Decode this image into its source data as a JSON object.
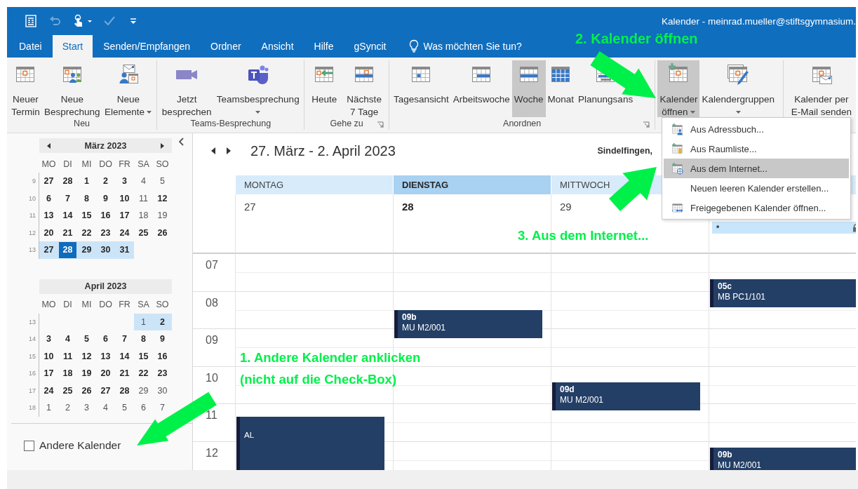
{
  "window": {
    "title": "Kalender - meinrad.mueller@stiftsgymnasium."
  },
  "quick_access": [
    {
      "disabled": false
    },
    {
      "disabled": true
    },
    {
      "disabled": false
    },
    {
      "disabled": true
    },
    {
      "disabled": false
    }
  ],
  "tabs": [
    {
      "label": "Datei",
      "selected": false
    },
    {
      "label": "Start",
      "selected": true
    },
    {
      "label": "Senden/Empfangen",
      "selected": false
    },
    {
      "label": "Ordner",
      "selected": false
    },
    {
      "label": "Ansicht",
      "selected": false
    },
    {
      "label": "Hilfe",
      "selected": false
    },
    {
      "label": "gSyncit",
      "selected": false
    }
  ],
  "tell_me": {
    "placeholder": "Was möchten Sie tun?"
  },
  "ribbon": {
    "groups": [
      {
        "label": "Neu",
        "launcher": false,
        "buttons": [
          {
            "lines": [
              "Neuer",
              "Termin"
            ],
            "dropdown": false,
            "selected": false
          },
          {
            "lines": [
              "Neue",
              "Besprechung"
            ],
            "dropdown": false,
            "selected": false
          },
          {
            "lines": [
              "Neue",
              "Elemente"
            ],
            "dropdown": true,
            "selected": false
          }
        ]
      },
      {
        "label": "Teams-Besprechung",
        "launcher": false,
        "buttons": [
          {
            "lines": [
              "Jetzt",
              "besprechen"
            ],
            "dropdown": false,
            "selected": false
          },
          {
            "lines": [
              "Teamsbesprechung"
            ],
            "dropdown": true,
            "selected": false
          }
        ]
      },
      {
        "label": "Gehe zu",
        "launcher": true,
        "buttons": [
          {
            "lines": [
              "Heute"
            ],
            "dropdown": false,
            "selected": false
          },
          {
            "lines": [
              "Nächste",
              "7 Tage"
            ],
            "dropdown": false,
            "selected": false
          }
        ]
      },
      {
        "label": "Anordnen",
        "launcher": true,
        "buttons": [
          {
            "lines": [
              "Tagesansicht"
            ],
            "dropdown": false,
            "selected": false
          },
          {
            "lines": [
              "Arbeitswoche"
            ],
            "dropdown": false,
            "selected": false
          },
          {
            "lines": [
              "Woche"
            ],
            "dropdown": false,
            "selected": true
          },
          {
            "lines": [
              "Monat"
            ],
            "dropdown": false,
            "selected": false
          },
          {
            "lines": [
              "Planungsans"
            ],
            "dropdown": false,
            "selected": false
          }
        ]
      },
      {
        "buttons": [
          {
            "lines": [
              "Kalender",
              "öffnen"
            ],
            "dropdown": true,
            "selected": true
          },
          {
            "lines": [
              "Kalendergruppen"
            ],
            "dropdown": true,
            "selected": false
          }
        ]
      },
      {
        "buttons": [
          {
            "lines": [
              "Kalender per",
              "E-Mail senden"
            ],
            "dropdown": false,
            "selected": false
          }
        ]
      }
    ]
  },
  "mini_calendars": [
    {
      "title": "März 2023",
      "nav": true,
      "weekdays": [
        "MO",
        "DI",
        "MI",
        "DO",
        "FR",
        "SA",
        "SO"
      ],
      "weeks": [
        {
          "week": "9",
          "days": [
            {
              "kind": "day",
              "d": "27",
              "bold": true,
              "selected": false,
              "today": false
            },
            {
              "kind": "day",
              "d": "28",
              "bold": true,
              "selected": false,
              "today": false
            },
            {
              "kind": "day",
              "d": "1",
              "bold": true,
              "selected": false,
              "today": false
            },
            {
              "kind": "day",
              "d": "2",
              "bold": true,
              "selected": false,
              "today": false
            },
            {
              "kind": "day",
              "d": "3",
              "bold": true,
              "selected": false,
              "today": false
            },
            {
              "kind": "day",
              "d": "4",
              "bold": false,
              "selected": false,
              "today": false
            },
            {
              "kind": "day",
              "d": "5",
              "bold": false,
              "selected": false,
              "today": false
            }
          ]
        },
        {
          "week": "10",
          "days": [
            {
              "kind": "day",
              "d": "6",
              "bold": true,
              "selected": false,
              "today": false
            },
            {
              "kind": "day",
              "d": "7",
              "bold": true,
              "selected": false,
              "today": false
            },
            {
              "kind": "day",
              "d": "8",
              "bold": true,
              "selected": false,
              "today": false
            },
            {
              "kind": "day",
              "d": "9",
              "bold": true,
              "selected": false,
              "today": false
            },
            {
              "kind": "day",
              "d": "10",
              "bold": true,
              "selected": false,
              "today": false
            },
            {
              "kind": "day",
              "d": "11",
              "bold": false,
              "selected": false,
              "today": false
            },
            {
              "kind": "day",
              "d": "12",
              "bold": true,
              "selected": false,
              "today": false
            }
          ]
        },
        {
          "week": "11",
          "days": [
            {
              "kind": "day",
              "d": "13",
              "bold": true,
              "selected": false,
              "today": false
            },
            {
              "kind": "day",
              "d": "14",
              "bold": true,
              "selected": false,
              "today": false
            },
            {
              "kind": "day",
              "d": "15",
              "bold": true,
              "selected": false,
              "today": false
            },
            {
              "kind": "day",
              "d": "16",
              "bold": true,
              "selected": false,
              "today": false
            },
            {
              "kind": "day",
              "d": "17",
              "bold": true,
              "selected": false,
              "today": false
            },
            {
              "kind": "day",
              "d": "18",
              "bold": false,
              "selected": false,
              "today": false
            },
            {
              "kind": "day",
              "d": "19",
              "bold": false,
              "selected": false,
              "today": false
            }
          ]
        },
        {
          "week": "12",
          "days": [
            {
              "kind": "day",
              "d": "20",
              "bold": true,
              "selected": false,
              "today": false
            },
            {
              "kind": "day",
              "d": "21",
              "bold": true,
              "selected": false,
              "today": false
            },
            {
              "kind": "day",
              "d": "22",
              "bold": true,
              "selected": false,
              "today": false
            },
            {
              "kind": "day",
              "d": "23",
              "bold": true,
              "selected": false,
              "today": false
            },
            {
              "kind": "day",
              "d": "24",
              "bold": true,
              "selected": false,
              "today": false
            },
            {
              "kind": "day",
              "d": "25",
              "bold": true,
              "selected": false,
              "today": false
            },
            {
              "kind": "day",
              "d": "26",
              "bold": true,
              "selected": false,
              "today": false
            }
          ]
        },
        {
          "week": "13",
          "days": [
            {
              "kind": "day",
              "d": "27",
              "bold": true,
              "selected": true,
              "today": false
            },
            {
              "kind": "day",
              "d": "28",
              "bold": true,
              "selected": true,
              "today": true
            },
            {
              "kind": "day",
              "d": "29",
              "bold": true,
              "selected": true,
              "today": false
            },
            {
              "kind": "day",
              "d": "30",
              "bold": true,
              "selected": true,
              "today": false
            },
            {
              "kind": "day",
              "d": "31",
              "bold": true,
              "selected": true,
              "today": false
            },
            {
              "kind": "blank"
            },
            {
              "kind": "blank"
            }
          ]
        }
      ]
    },
    {
      "title": "April 2023",
      "nav": false,
      "weekdays": [
        "MO",
        "DI",
        "MI",
        "DO",
        "FR",
        "SA",
        "SO"
      ],
      "weeks": [
        {
          "week": "13",
          "days": [
            {
              "kind": "blank"
            },
            {
              "kind": "blank"
            },
            {
              "kind": "blank"
            },
            {
              "kind": "blank"
            },
            {
              "kind": "blank"
            },
            {
              "kind": "day",
              "d": "1",
              "bold": false,
              "selected": true,
              "today": false
            },
            {
              "kind": "day",
              "d": "2",
              "bold": true,
              "selected": true,
              "today": false
            }
          ]
        },
        {
          "week": "14",
          "days": [
            {
              "kind": "day",
              "d": "3",
              "bold": true,
              "selected": false,
              "today": false
            },
            {
              "kind": "day",
              "d": "4",
              "bold": true,
              "selected": false,
              "today": false
            },
            {
              "kind": "day",
              "d": "5",
              "bold": true,
              "selected": false,
              "today": false
            },
            {
              "kind": "day",
              "d": "6",
              "bold": true,
              "selected": false,
              "today": false
            },
            {
              "kind": "day",
              "d": "7",
              "bold": true,
              "selected": false,
              "today": false
            },
            {
              "kind": "day",
              "d": "8",
              "bold": true,
              "selected": false,
              "today": false
            },
            {
              "kind": "day",
              "d": "9",
              "bold": true,
              "selected": false,
              "today": false
            }
          ]
        },
        {
          "week": "15",
          "days": [
            {
              "kind": "day",
              "d": "10",
              "bold": true,
              "selected": false,
              "today": false
            },
            {
              "kind": "day",
              "d": "11",
              "bold": true,
              "selected": false,
              "today": false
            },
            {
              "kind": "day",
              "d": "12",
              "bold": true,
              "selected": false,
              "today": false
            },
            {
              "kind": "day",
              "d": "13",
              "bold": true,
              "selected": false,
              "today": false
            },
            {
              "kind": "day",
              "d": "14",
              "bold": true,
              "selected": false,
              "today": false
            },
            {
              "kind": "day",
              "d": "15",
              "bold": true,
              "selected": false,
              "today": false
            },
            {
              "kind": "day",
              "d": "16",
              "bold": true,
              "selected": false,
              "today": false
            }
          ]
        },
        {
          "week": "16",
          "days": [
            {
              "kind": "day",
              "d": "17",
              "bold": true,
              "selected": false,
              "today": false
            },
            {
              "kind": "day",
              "d": "18",
              "bold": true,
              "selected": false,
              "today": false
            },
            {
              "kind": "day",
              "d": "19",
              "bold": true,
              "selected": false,
              "today": false
            },
            {
              "kind": "day",
              "d": "20",
              "bold": true,
              "selected": false,
              "today": false
            },
            {
              "kind": "day",
              "d": "21",
              "bold": true,
              "selected": false,
              "today": false
            },
            {
              "kind": "day",
              "d": "22",
              "bold": true,
              "selected": false,
              "today": false
            },
            {
              "kind": "day",
              "d": "23",
              "bold": true,
              "selected": false,
              "today": false
            }
          ]
        },
        {
          "week": "17",
          "days": [
            {
              "kind": "day",
              "d": "24",
              "bold": true,
              "selected": false,
              "today": false
            },
            {
              "kind": "day",
              "d": "25",
              "bold": true,
              "selected": false,
              "today": false
            },
            {
              "kind": "day",
              "d": "26",
              "bold": true,
              "selected": false,
              "today": false
            },
            {
              "kind": "day",
              "d": "27",
              "bold": true,
              "selected": false,
              "today": false
            },
            {
              "kind": "day",
              "d": "28",
              "bold": true,
              "selected": false,
              "today": false
            },
            {
              "kind": "day",
              "d": "29",
              "bold": false,
              "selected": false,
              "today": false
            },
            {
              "kind": "day",
              "d": "30",
              "bold": false,
              "selected": false,
              "today": false
            }
          ]
        },
        {
          "week": "18",
          "days": [
            {
              "kind": "day",
              "d": "1",
              "bold": false,
              "selected": false,
              "today": false
            },
            {
              "kind": "day",
              "d": "2",
              "bold": false,
              "selected": false,
              "today": false
            },
            {
              "kind": "day",
              "d": "3",
              "bold": false,
              "selected": false,
              "today": false
            },
            {
              "kind": "day",
              "d": "4",
              "bold": false,
              "selected": false,
              "today": false
            },
            {
              "kind": "day",
              "d": "5",
              "bold": false,
              "selected": false,
              "today": false
            },
            {
              "kind": "day",
              "d": "6",
              "bold": false,
              "selected": false,
              "today": false
            },
            {
              "kind": "day",
              "d": "7",
              "bold": false,
              "selected": false,
              "today": false
            }
          ]
        }
      ]
    }
  ],
  "other_calendars": {
    "label": "Andere Kalender",
    "checked": false
  },
  "calendar": {
    "title": "27. März - 2. April 2023",
    "location": "Sindelfingen,",
    "hours": [
      "07",
      "08",
      "09",
      "10",
      "11",
      "12"
    ],
    "days": [
      {
        "label": "MONTAG",
        "date": "27",
        "today": false,
        "events": [
          {
            "title": "AL"
          }
        ]
      },
      {
        "label": "DIENSTAG",
        "date": "28",
        "today": true,
        "events": [
          {
            "title": "09b",
            "location": "MU M2/001"
          }
        ]
      },
      {
        "label": "MITTWOCH",
        "date": "29",
        "today": false,
        "events": [
          {
            "title": "09d",
            "location": "MU M2/001"
          }
        ]
      },
      {
        "today": false,
        "all_day": [
          {
            "title": "*",
            "locked": true
          }
        ],
        "events": [
          {
            "title": "05c",
            "location": "MB PC1/101"
          },
          {
            "title": "09b",
            "location": "MU M2/001"
          }
        ]
      }
    ]
  },
  "menu": {
    "items": [
      {
        "label": "Aus Adressbuch...",
        "selected": false
      },
      {
        "label": "Aus Raumliste...",
        "selected": false
      },
      {
        "label": "Aus dem Internet...",
        "selected": true
      },
      {
        "label": "Neuen leeren Kalender erstellen...",
        "selected": false
      },
      {
        "label": "Freigegebenen Kalender öffnen...",
        "selected": false
      }
    ]
  },
  "annotations": [
    {
      "lines": [
        "2. Kalender öffnen"
      ]
    },
    {
      "lines": [
        "3. Aus dem Internet..."
      ]
    },
    {
      "lines": [
        "1. Andere Kalender anklicken",
        "(nicht auf die Check-Box)"
      ]
    }
  ]
}
